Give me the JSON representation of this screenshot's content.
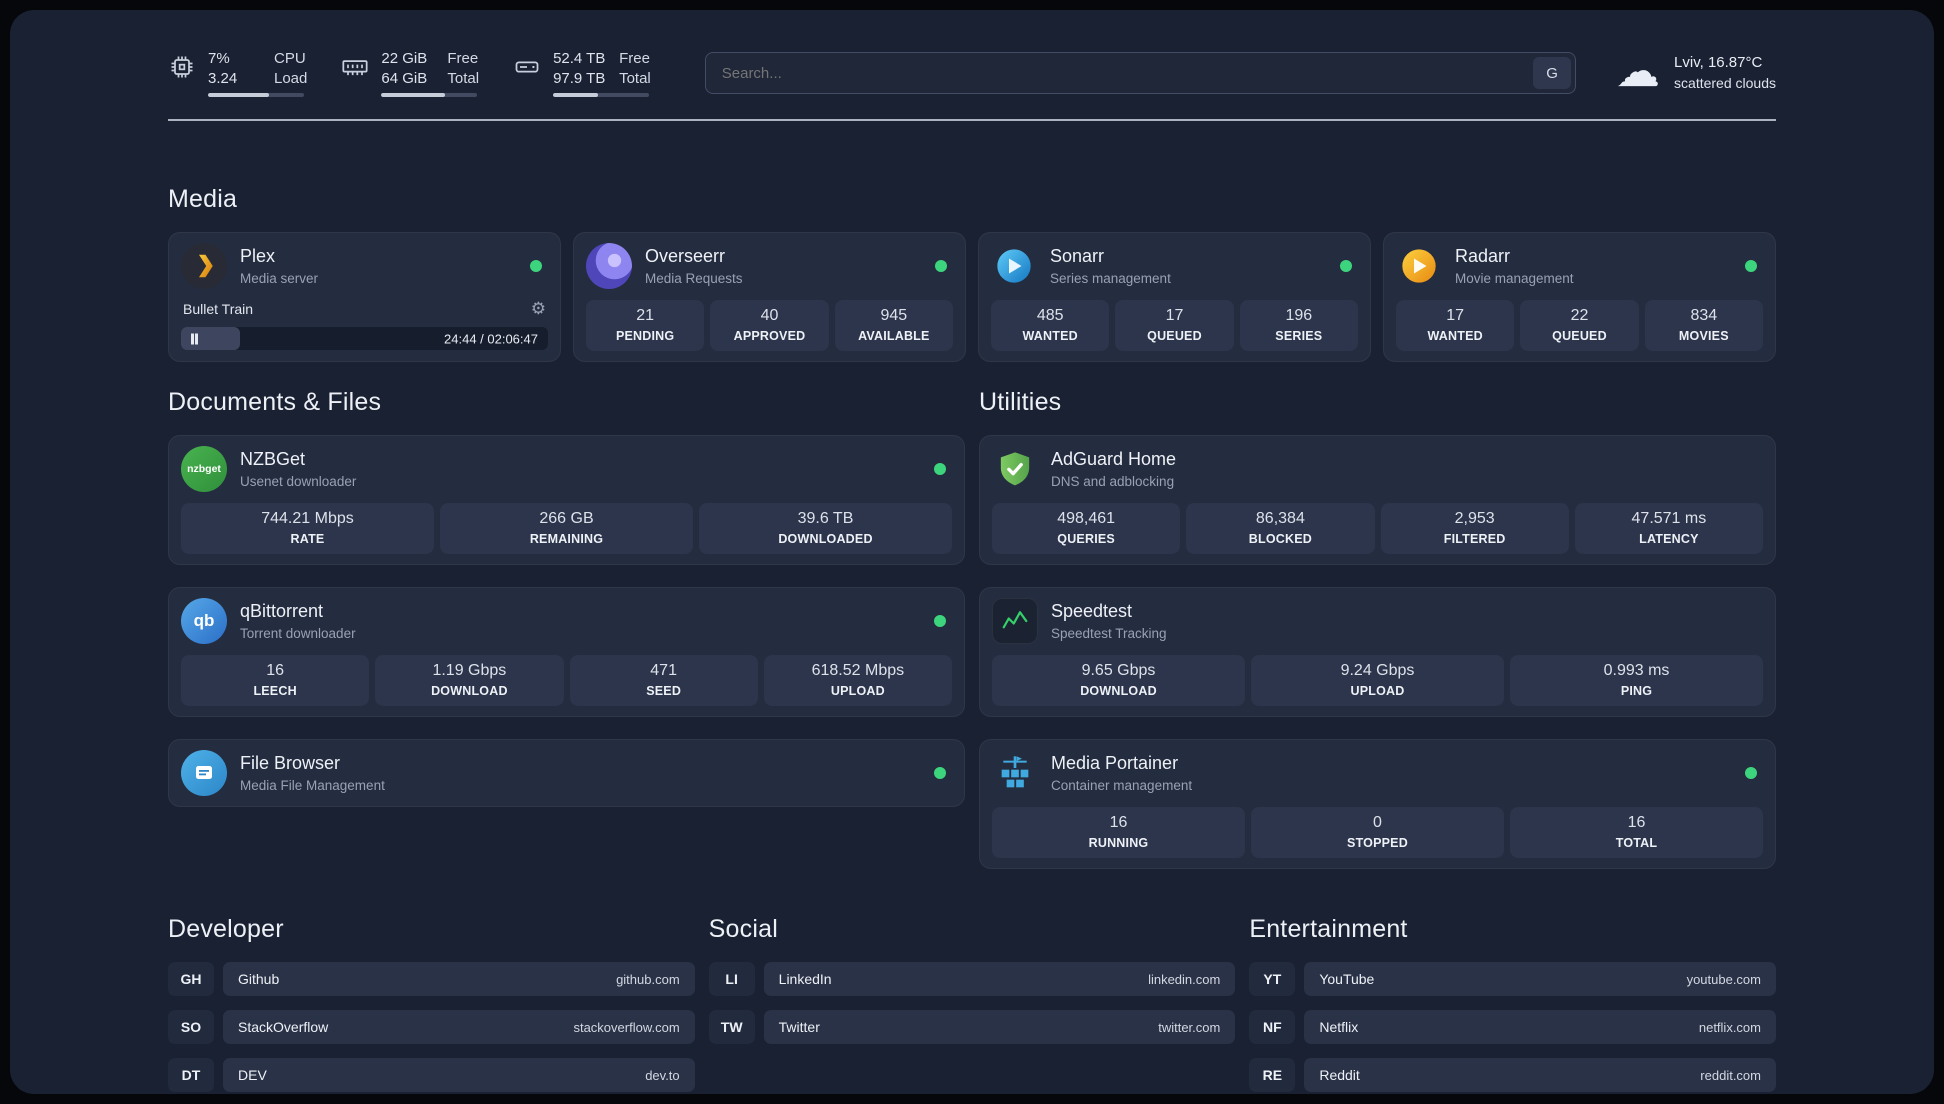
{
  "topbar": {
    "cpu": {
      "value1": "7%",
      "value2": "3.24",
      "label1": "CPU",
      "label2": "Load",
      "bar_percent": 64
    },
    "ram": {
      "value1": "22 GiB",
      "value2": "64 GiB",
      "label1": "Free",
      "label2": "Total",
      "bar_percent": 66
    },
    "disk": {
      "value1": "52.4 TB",
      "value2": "97.9 TB",
      "label1": "Free",
      "label2": "Total",
      "bar_percent": 47
    },
    "search": {
      "placeholder": "Search...",
      "engine_label": "G"
    },
    "weather": {
      "location": "Lviv, 16.87°C",
      "condition": "scattered clouds"
    }
  },
  "media": {
    "title": "Media",
    "plex": {
      "name": "Plex",
      "desc": "Media server",
      "now_playing": {
        "title": "Bullet Train",
        "time": "24:44 / 02:06:47",
        "progress_percent": 16
      }
    },
    "overseerr": {
      "name": "Overseerr",
      "desc": "Media Requests",
      "stats": [
        {
          "value": "21",
          "label": "PENDING"
        },
        {
          "value": "40",
          "label": "APPROVED"
        },
        {
          "value": "945",
          "label": "AVAILABLE"
        }
      ]
    },
    "sonarr": {
      "name": "Sonarr",
      "desc": "Series management",
      "stats": [
        {
          "value": "485",
          "label": "WANTED"
        },
        {
          "value": "17",
          "label": "QUEUED"
        },
        {
          "value": "196",
          "label": "SERIES"
        }
      ]
    },
    "radarr": {
      "name": "Radarr",
      "desc": "Movie management",
      "stats": [
        {
          "value": "17",
          "label": "WANTED"
        },
        {
          "value": "22",
          "label": "QUEUED"
        },
        {
          "value": "834",
          "label": "MOVIES"
        }
      ]
    }
  },
  "documents": {
    "title": "Documents & Files",
    "nzbget": {
      "name": "NZBGet",
      "desc": "Usenet downloader",
      "icon_text": "nzbget",
      "stats": [
        {
          "value": "744.21 Mbps",
          "label": "RATE"
        },
        {
          "value": "266 GB",
          "label": "REMAINING"
        },
        {
          "value": "39.6 TB",
          "label": "DOWNLOADED"
        }
      ]
    },
    "qbittorrent": {
      "name": "qBittorrent",
      "desc": "Torrent downloader",
      "icon_text": "qb",
      "stats": [
        {
          "value": "16",
          "label": "LEECH"
        },
        {
          "value": "1.19 Gbps",
          "label": "DOWNLOAD"
        },
        {
          "value": "471",
          "label": "SEED"
        },
        {
          "value": "618.52 Mbps",
          "label": "UPLOAD"
        }
      ]
    },
    "filebrowser": {
      "name": "File Browser",
      "desc": "Media File Management"
    }
  },
  "utilities": {
    "title": "Utilities",
    "adguard": {
      "name": "AdGuard Home",
      "desc": "DNS and adblocking",
      "stats": [
        {
          "value": "498,461",
          "label": "QUERIES"
        },
        {
          "value": "86,384",
          "label": "BLOCKED"
        },
        {
          "value": "2,953",
          "label": "FILTERED"
        },
        {
          "value": "47.571 ms",
          "label": "LATENCY"
        }
      ]
    },
    "speedtest": {
      "name": "Speedtest",
      "desc": "Speedtest Tracking",
      "stats": [
        {
          "value": "9.65 Gbps",
          "label": "DOWNLOAD"
        },
        {
          "value": "9.24 Gbps",
          "label": "UPLOAD"
        },
        {
          "value": "0.993 ms",
          "label": "PING"
        }
      ]
    },
    "portainer": {
      "name": "Media Portainer",
      "desc": "Container management",
      "stats": [
        {
          "value": "16",
          "label": "RUNNING"
        },
        {
          "value": "0",
          "label": "STOPPED"
        },
        {
          "value": "16",
          "label": "TOTAL"
        }
      ]
    }
  },
  "bookmarks": {
    "developer": {
      "title": "Developer",
      "items": [
        {
          "abbr": "GH",
          "name": "Github",
          "url": "github.com"
        },
        {
          "abbr": "SO",
          "name": "StackOverflow",
          "url": "stackoverflow.com"
        },
        {
          "abbr": "DT",
          "name": "DEV",
          "url": "dev.to"
        }
      ]
    },
    "social": {
      "title": "Social",
      "items": [
        {
          "abbr": "LI",
          "name": "LinkedIn",
          "url": "linkedin.com"
        },
        {
          "abbr": "TW",
          "name": "Twitter",
          "url": "twitter.com"
        }
      ]
    },
    "entertainment": {
      "title": "Entertainment",
      "items": [
        {
          "abbr": "YT",
          "name": "YouTube",
          "url": "youtube.com"
        },
        {
          "abbr": "NF",
          "name": "Netflix",
          "url": "netflix.com"
        },
        {
          "abbr": "RE",
          "name": "Reddit",
          "url": "reddit.com"
        }
      ]
    }
  },
  "colors": {
    "status_online": "#3dd47e",
    "background": "#192133",
    "card": "#242c3f"
  }
}
